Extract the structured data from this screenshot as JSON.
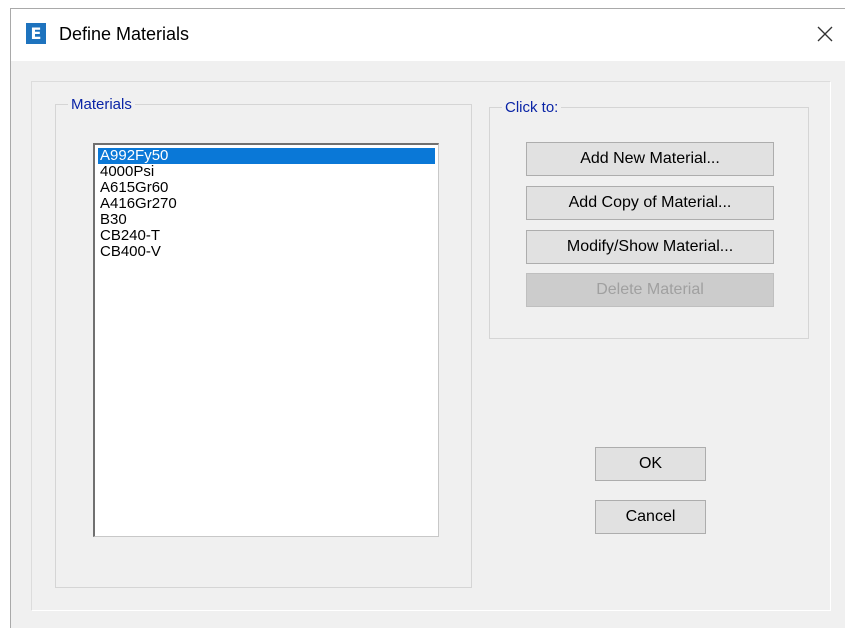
{
  "window": {
    "title": "Define Materials",
    "icon_letter": "E",
    "icon_color": "#1e73be",
    "close_glyph": "close-icon"
  },
  "materials": {
    "label": "Materials",
    "items": [
      "A992Fy50",
      "4000Psi",
      "A615Gr60",
      "A416Gr270",
      "B30",
      "CB240-T",
      "CB400-V"
    ],
    "selected_index": 0,
    "selection_color": "#0a78d7"
  },
  "actions": {
    "label": "Click to:",
    "add_new": "Add New Material...",
    "add_copy": "Add Copy of Material...",
    "modify_show": "Modify/Show Material...",
    "delete": "Delete Material"
  },
  "footer": {
    "ok": "OK",
    "cancel": "Cancel"
  }
}
